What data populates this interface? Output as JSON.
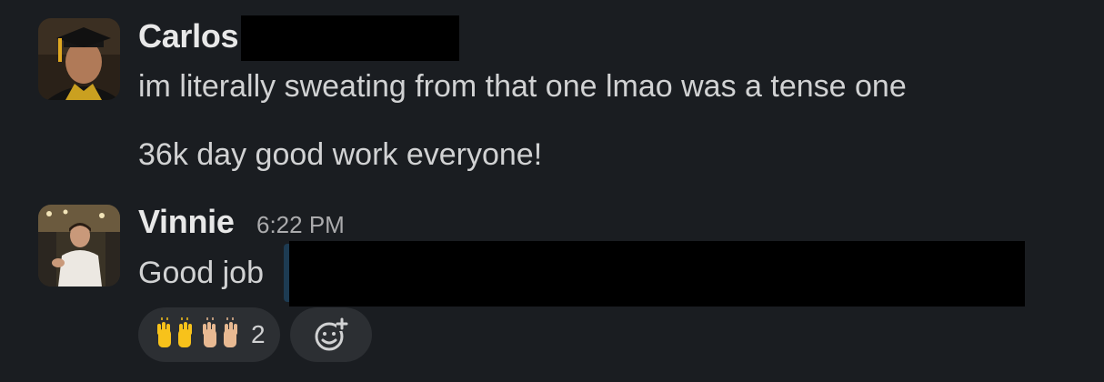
{
  "messages": [
    {
      "sender": "Carlos",
      "lines": [
        "im literally sweating from that one lmao was a tense one",
        "36k day good work everyone!"
      ]
    },
    {
      "sender": "Vinnie",
      "timestamp": "6:22 PM",
      "text": "Good job",
      "reactions": [
        {
          "emoji": "raised-hands",
          "count": "2"
        }
      ]
    }
  ],
  "colors": {
    "background": "#1a1d21",
    "pill": "#2c2f33",
    "text": "#d1d2d3",
    "muted": "#ababad"
  },
  "icons": {
    "add_reaction": "add-reaction-icon",
    "reaction_emoji": "raised-hands-emoji"
  }
}
